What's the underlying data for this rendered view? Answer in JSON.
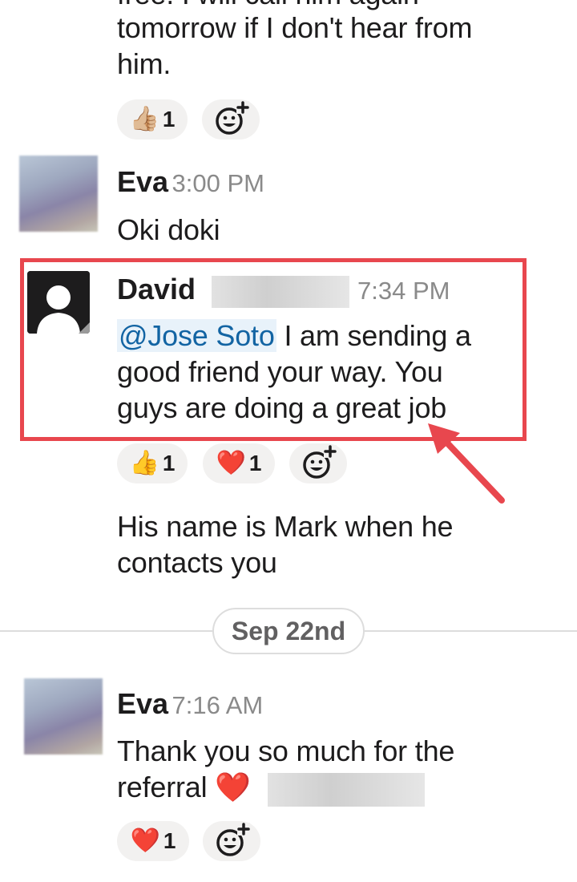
{
  "messages": {
    "top_partial": {
      "line_cut": "free. I will call him again",
      "line1": "tomorrow if I don't hear from",
      "line2": "him.",
      "reactions": [
        {
          "emoji": "👍🏼",
          "count": "1"
        }
      ]
    },
    "eva_1": {
      "author": "Eva",
      "time": "3:00 PM",
      "text": "Oki doki"
    },
    "david": {
      "author": "David",
      "time": "7:34 PM",
      "mention": "@Jose Soto",
      "line1_rest": " I am sending a",
      "line2": "good friend your way. You",
      "line3": "guys are doing a great job",
      "reactions": [
        {
          "emoji": "👍",
          "count": "1"
        },
        {
          "emoji": "❤️",
          "count": "1"
        }
      ]
    },
    "david_followup": {
      "line1": "His name is Mark when he",
      "line2": "contacts you"
    },
    "date_divider": "Sep 22nd",
    "eva_2": {
      "author": "Eva",
      "time": "7:16 AM",
      "line1": "Thank you so much for the",
      "line2": "referral",
      "heart": "❤️",
      "reactions": [
        {
          "emoji": "❤️",
          "count": "1"
        }
      ]
    }
  },
  "colors": {
    "highlight": "#e8474e",
    "mention": "#1264a3",
    "timestamp": "#8a8a8a"
  },
  "icons": {
    "add_reaction": "add-reaction-icon",
    "default_avatar": "default-avatar-icon"
  }
}
